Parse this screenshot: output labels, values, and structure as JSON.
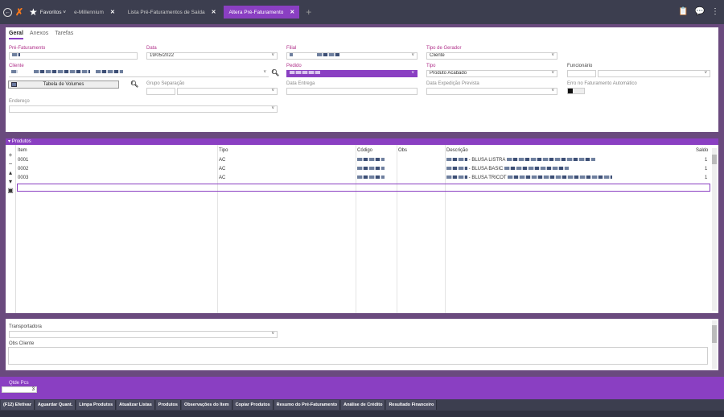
{
  "tabs": [
    {
      "label": "e-Millennium",
      "active": false
    },
    {
      "label": "Lista Pré-Faturamentos de Saída",
      "active": false
    },
    {
      "label": "Altera Pré-Faturamento",
      "active": true
    }
  ],
  "favorites_label": "Favoritos",
  "subtabs": [
    "Geral",
    "Anexos",
    "Tarefas"
  ],
  "form": {
    "pre_faturamento_label": "Pré-Faturamento",
    "data_label": "Data",
    "data_value": "19/05/2022",
    "filial_label": "Filial",
    "tipo_gerador_label": "Tipo de Gerador",
    "tipo_gerador_value": "Cliente",
    "cliente_label": "Cliente",
    "pedido_label": "Pedido",
    "tipo_label": "Tipo",
    "tipo_value": "Produto Acabado",
    "funcionario_label": "Funcionário",
    "tabela_volumes_label": "Tabela de Volumes",
    "grupo_separacao_label": "Grupo Separação",
    "data_entrega_label": "Data Entrega",
    "data_expedicao_label": "Data Expedição Prevista",
    "erro_faturamento_label": "Erro no Faturamento Automático",
    "endereco_label": "Endereço"
  },
  "produtos": {
    "section_label": "Produtos",
    "columns": [
      "Item",
      "Tipo",
      "Código",
      "Obs",
      "Descrição",
      "Saldo"
    ],
    "rows": [
      {
        "item": "0001",
        "tipo": "AC",
        "descricao": "- BLUSA LISTRA",
        "saldo": "1"
      },
      {
        "item": "0002",
        "tipo": "AC",
        "descricao": "- BLUSA BASIC",
        "saldo": "1"
      },
      {
        "item": "0003",
        "tipo": "AC",
        "descricao": "- BLUSA TRICOT",
        "saldo": "1"
      }
    ]
  },
  "bottom": {
    "transportadora_label": "Transportadora",
    "obs_cliente_label": "Obs Cliente",
    "qtde_label": "Qtde Pcs",
    "qtde_value": "3"
  },
  "footer_buttons": [
    "(F12) Efetivar",
    "Aguardar Quant.",
    "Limpa Produtos",
    "Atualizar Listas",
    "Produtos",
    "Observações do Item",
    "Copiar Produtos",
    "Resumo do Pré-Faturamento",
    "Análise de Crédito",
    "Resultado Financeiro"
  ],
  "colors": {
    "accent": "#8a3fc2",
    "topbar": "#3c3e4f",
    "background": "#6a4a7e"
  }
}
